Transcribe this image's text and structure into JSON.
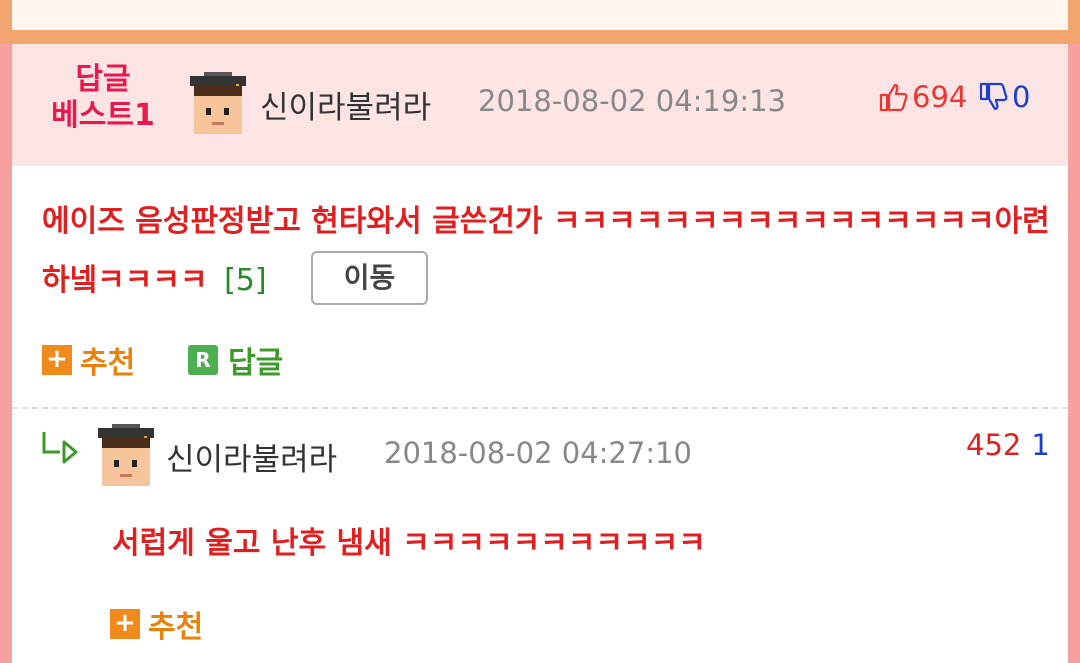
{
  "best_comment": {
    "label_line1": "답글",
    "label_line2": "베스트1",
    "author": "신이라불려라",
    "date": "2018-08-02 04:19:13",
    "upvotes": "694",
    "downvotes": "0",
    "text": "에이즈 음성판정받고 현타와서 글쓴건가 ㅋㅋㅋㅋㅋㅋㅋㅋㅋㅋㅋㅋㅋㅋㅋㅋ아련하넼ㅋㅋㅋㅋ",
    "reply_count": "[5]",
    "move_button": "이동",
    "recommend_label": "추천",
    "reply_label": "답글"
  },
  "reply": {
    "author": "신이라불려라",
    "date": "2018-08-02 04:27:10",
    "upvotes": "452",
    "downvotes": "1",
    "text": "서럽게 울고 난후 냄새 ㅋㅋㅋㅋㅋㅋㅋㅋㅋㅋㅋ",
    "recommend_label": "추천"
  },
  "colors": {
    "best_header_bg": "#fde4e4",
    "frame_pink": "#f8a0a0",
    "frame_orange": "#f3a56f",
    "comment_red": "#e02020",
    "recommend_orange": "#e8820c",
    "reply_green": "#3c9a2a",
    "downvote_blue": "#1a3fc9"
  },
  "icons": [
    "thumbs-up-icon",
    "thumbs-down-icon",
    "plus-icon",
    "reply-r-icon",
    "reply-arrow-icon",
    "avatar-graduate"
  ]
}
